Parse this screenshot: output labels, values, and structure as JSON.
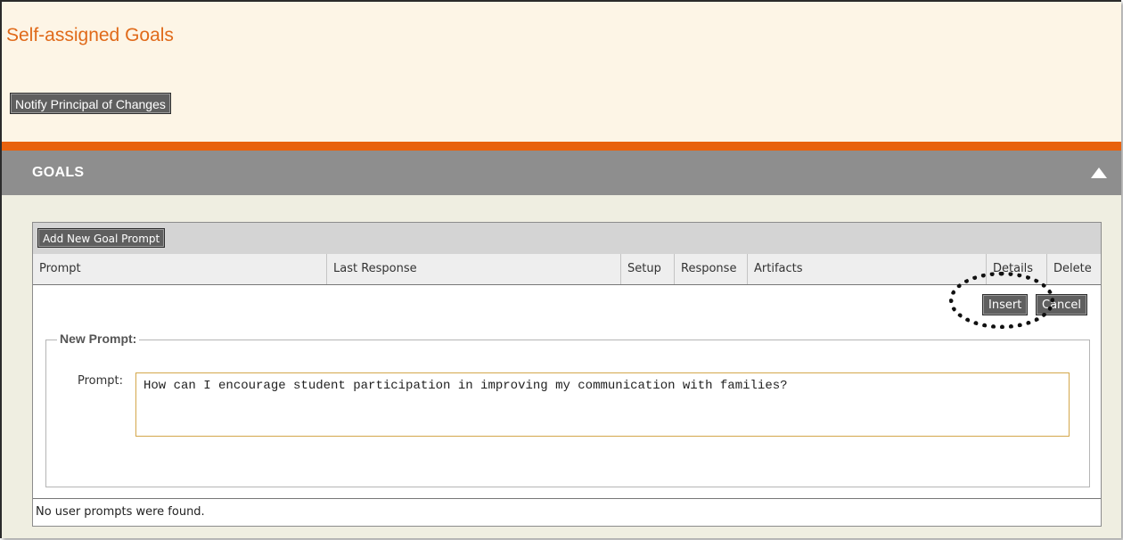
{
  "page": {
    "title": "Self-assigned Goals",
    "notify_button": "Notify Principal of Changes"
  },
  "section": {
    "title": "GOALS",
    "collapse_icon": "triangle-up-icon"
  },
  "grid": {
    "add_button": "Add New Goal Prompt",
    "columns": [
      "Prompt",
      "Last Response",
      "Setup",
      "Response",
      "Artifacts",
      "Details",
      "Delete"
    ],
    "insert_button": "Insert",
    "cancel_button": "Cancel",
    "form": {
      "legend": "New Prompt:",
      "prompt_label": "Prompt:",
      "prompt_value": "How can I encourage student participation in improving my communication with families?"
    },
    "empty_message": "No user prompts were found."
  },
  "colors": {
    "title_orange": "#e06a1a",
    "accent_bar": "#e8620e",
    "header_gray": "#8e8e8e",
    "background_cream": "#fdf5e6"
  }
}
